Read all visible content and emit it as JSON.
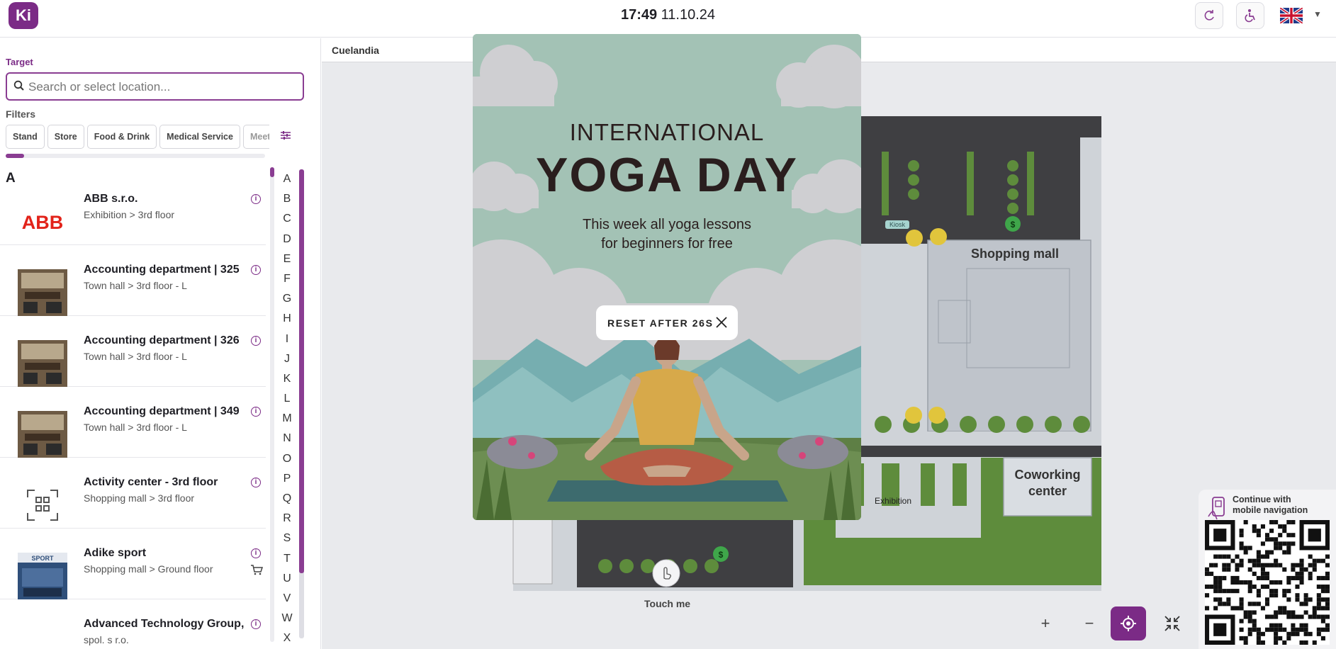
{
  "header": {
    "logo_text": "Ki",
    "time": "17:49",
    "date": "11.10.24",
    "refresh_icon": "refresh-icon",
    "accessibility_icon": "wheelchair-icon",
    "language_flag": "uk-flag-icon"
  },
  "sidebar": {
    "target_label": "Target",
    "search_placeholder": "Search or select location...",
    "filters_label": "Filters",
    "filters": [
      "Stand",
      "Store",
      "Food & Drink",
      "Medical Service",
      "Meeti"
    ],
    "filters_scroll_fraction": 0.07,
    "section_letter": "A",
    "items": [
      {
        "name": "ABB s.r.o.",
        "path": "Exhibition > 3rd floor",
        "thumb": "abb-logo"
      },
      {
        "name": "Accounting department | 325",
        "path": "Town hall > 3rd floor - L",
        "thumb": "office-photo"
      },
      {
        "name": "Accounting department | 326",
        "path": "Town hall > 3rd floor - L",
        "thumb": "office-photo"
      },
      {
        "name": "Accounting department | 349",
        "path": "Town hall > 3rd floor - L",
        "thumb": "office-photo"
      },
      {
        "name": "Activity center - 3rd floor",
        "path": "Shopping mall > 3rd floor",
        "thumb": "placeholder-icon"
      },
      {
        "name": "Adike sport",
        "path": "Shopping mall > Ground floor",
        "thumb": "store-photo",
        "cart": true
      },
      {
        "name": "Advanced Technology Group,",
        "path": "spol. s r.o.",
        "thumb": "atg-logo"
      }
    ],
    "alphabet": [
      "A",
      "B",
      "C",
      "D",
      "E",
      "F",
      "G",
      "H",
      "I",
      "J",
      "K",
      "L",
      "M",
      "N",
      "O",
      "P",
      "Q",
      "R",
      "S",
      "T",
      "U",
      "V",
      "W",
      "X"
    ]
  },
  "map": {
    "breadcrumb": "Cuelandia",
    "labels": {
      "shopping_mall": "Shopping mall",
      "coworking_line1": "Coworking",
      "coworking_line2": "center",
      "exhibition": "Exhibition",
      "kiosk": "Kiosk"
    },
    "touch_label": "Touch me",
    "zoom_in": "+",
    "zoom_out": "−",
    "qr_title_line1": "Continue with",
    "qr_title_line2": "mobile navigation"
  },
  "promo": {
    "line1": "INTERNATIONAL",
    "line2": "YOGA DAY",
    "line3": "This week all yoga lessons",
    "line4": "for beginners for free",
    "reset_label": "RESET AFTER 26S"
  },
  "colors": {
    "accent": "#7b2b86",
    "promo_sky": "#a3c2b5",
    "map_green": "#5e8c3c"
  }
}
